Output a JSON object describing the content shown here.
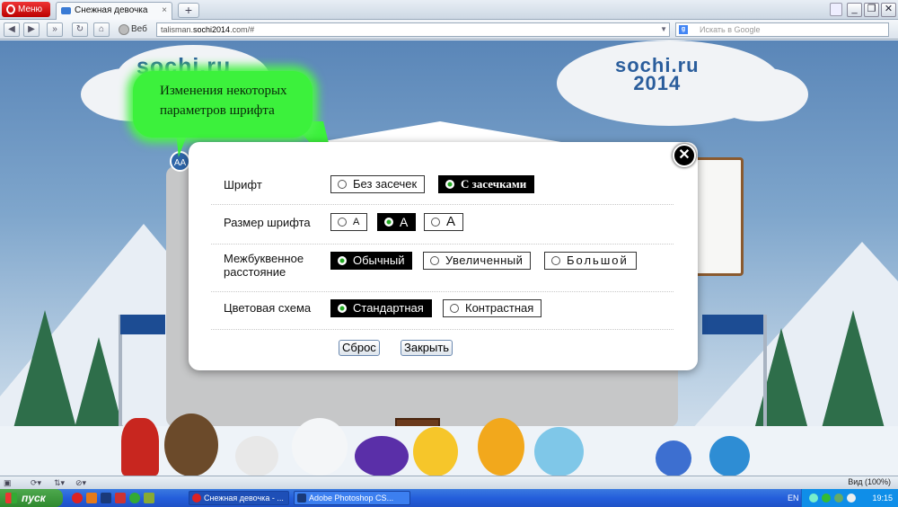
{
  "browser": {
    "menu_label": "Меню",
    "tab_title": "Снежная девочка",
    "tab_close": "×",
    "new_tab": "+",
    "web_label": "Веб",
    "url_prefix": "talisman.",
    "url_host": "sochi2014",
    "url_suffix": ".com/#",
    "search_placeholder": "Искать в Google",
    "win_buttons": [
      "_",
      "❐",
      "✕"
    ]
  },
  "page": {
    "logo_left": "sochi.ru",
    "logo_right_line1": "sochi.ru",
    "logo_right_line2": "2014",
    "aa_button": "AA",
    "callout_text": "Изменения некоторых параметров шрифта"
  },
  "modal": {
    "close_label": "✕",
    "rows": [
      {
        "label": "Шрифт",
        "options": [
          "Без засечек",
          "С засечками"
        ],
        "selected": 1
      },
      {
        "label": "Размер шрифта",
        "options": [
          "А",
          "А",
          "А"
        ],
        "selected": 1
      },
      {
        "label_line1": "Межбуквенное",
        "label_line2": "расстояние",
        "options": [
          "Обычный",
          "Увеличенный",
          "Большой"
        ],
        "selected": 0
      },
      {
        "label": "Цветовая схема",
        "options": [
          "Стандартная",
          "Контрастная"
        ],
        "selected": 0
      }
    ],
    "reset_label": "Сброс",
    "close_button_label": "Закрыть"
  },
  "status": {
    "zoom": "Вид (100%)"
  },
  "taskbar": {
    "start_label": "пуск",
    "tasks": [
      "Снежная девочка - ...",
      "Adobe Photoshop CS..."
    ],
    "lang": "EN",
    "clock": "19:15"
  },
  "colors": {
    "callout": "#3cf13c",
    "selected_option": "#000000",
    "flag": "#1c4c93"
  }
}
